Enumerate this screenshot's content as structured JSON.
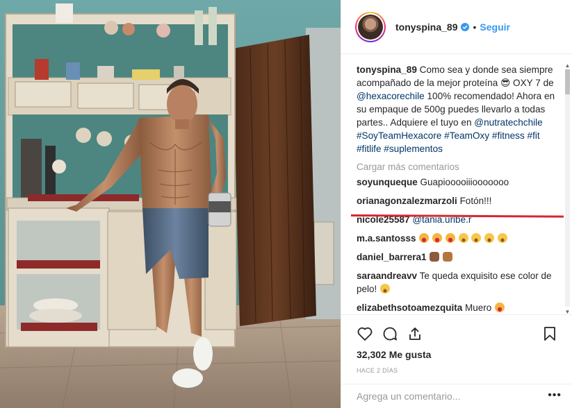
{
  "header": {
    "username": "tonyspina_89",
    "separator": "•",
    "follow_label": "Seguir"
  },
  "caption": {
    "username": "tonyspina_89",
    "text1": "Como sea y donde sea siempre acompañado de la mejor proteína",
    "emoji": "😎",
    "text2": "OXY 7 de",
    "mention1": "@hexacorechile",
    "text3": "100% recomendado! Ahora en su empaque de 500g puedes llevarlo a todas partes.. Adquiere el tuyo en",
    "mention2": "@nutratechchile",
    "hashtags": "#SoyTeamHexacore #TeamOxy #fitness #fit #fitlife #suplementos"
  },
  "load_more": "Cargar más comentarios",
  "comments": [
    {
      "user": "soyunqueque",
      "text": "Guapiooooiiiooooooo"
    },
    {
      "user": "orianagonzalezmarzoli",
      "text": "Fotón!!!"
    },
    {
      "user": "nicole25587",
      "mention": "@tania.uribe.r"
    },
    {
      "user": "m.a.santosss",
      "emojis": [
        "h",
        "h",
        "h",
        "s",
        "s",
        "s",
        "s"
      ]
    },
    {
      "user": "daniel_barrera1",
      "emojis": [
        "f",
        "m"
      ]
    },
    {
      "user": "saraandreavv",
      "text": "Te queda exquisito ese color de pelo!",
      "emojis": [
        "s"
      ]
    },
    {
      "user": "elizabethsotoamezquita",
      "text": "Muero",
      "emojis": [
        "h"
      ]
    }
  ],
  "stats": {
    "likes_count": "32,302",
    "likes_label": "Me gusta",
    "time_ago": "HACE 2 DÍAS"
  },
  "comment_input": {
    "placeholder": "Agrega un comentario..."
  },
  "options_glyph": "•••",
  "icons": [
    "heart-icon",
    "comment-icon",
    "share-icon",
    "bookmark-icon",
    "verified-icon",
    "more-options-icon"
  ],
  "colors": {
    "link": "#003569",
    "follow": "#3897f0",
    "muted": "#999999",
    "annotation_red": "#d8262e"
  }
}
